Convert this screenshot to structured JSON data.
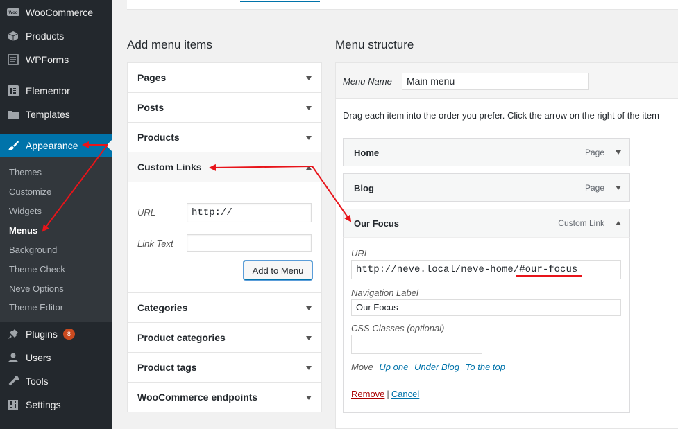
{
  "sidebar": {
    "top_items": [
      {
        "label": "WooCommerce",
        "icon": "woocommerce-icon"
      },
      {
        "label": "Products",
        "icon": "box-icon"
      },
      {
        "label": "WPForms",
        "icon": "form-icon"
      },
      {
        "label": "Elementor",
        "icon": "elementor-icon"
      },
      {
        "label": "Templates",
        "icon": "folder-icon"
      },
      {
        "label": "Appearance",
        "icon": "paintbrush-icon"
      }
    ],
    "appearance_sub": [
      {
        "label": "Themes"
      },
      {
        "label": "Customize"
      },
      {
        "label": "Widgets"
      },
      {
        "label": "Menus"
      },
      {
        "label": "Background"
      },
      {
        "label": "Theme Check"
      },
      {
        "label": "Neve Options"
      },
      {
        "label": "Theme Editor"
      }
    ],
    "bottom_items": [
      {
        "label": "Plugins",
        "icon": "plugin-icon",
        "badge": "8"
      },
      {
        "label": "Users",
        "icon": "user-icon"
      },
      {
        "label": "Tools",
        "icon": "wrench-icon"
      },
      {
        "label": "Settings",
        "icon": "settings-icon"
      }
    ],
    "colors": {
      "bg": "#23282d",
      "active": "#0073aa",
      "badge": "#ca4a1f"
    }
  },
  "add_menu_items": {
    "title": "Add menu items",
    "sections": [
      {
        "label": "Pages"
      },
      {
        "label": "Posts"
      },
      {
        "label": "Products"
      },
      {
        "label": "Custom Links"
      }
    ],
    "custom_links": {
      "url_label": "URL",
      "url_value": "http://",
      "link_text_label": "Link Text",
      "link_text_value": "",
      "add_button": "Add to Menu"
    },
    "more_sections": [
      {
        "label": "Categories"
      },
      {
        "label": "Product categories"
      },
      {
        "label": "Product tags"
      },
      {
        "label": "WooCommerce endpoints"
      }
    ]
  },
  "menu_structure": {
    "title": "Menu structure",
    "menu_name_label": "Menu Name",
    "menu_name_value": "Main menu",
    "instructions": "Drag each item into the order you prefer. Click the arrow on the right of the item",
    "items": [
      {
        "title": "Home",
        "type": "Page"
      },
      {
        "title": "Blog",
        "type": "Page"
      },
      {
        "title": "Our Focus",
        "type": "Custom Link"
      }
    ],
    "editor": {
      "url_label": "URL",
      "url_value": "http://neve.local/neve-home/#our-focus",
      "nav_label_label": "Navigation Label",
      "nav_label_value": "Our Focus",
      "css_label": "CSS Classes (optional)",
      "css_value": "",
      "move_label": "Move",
      "move_up": "Up one",
      "move_under": "Under Blog",
      "move_top": "To the top",
      "remove": "Remove",
      "separator": "|",
      "cancel": "Cancel"
    }
  },
  "annotation_color": "#e8141a"
}
